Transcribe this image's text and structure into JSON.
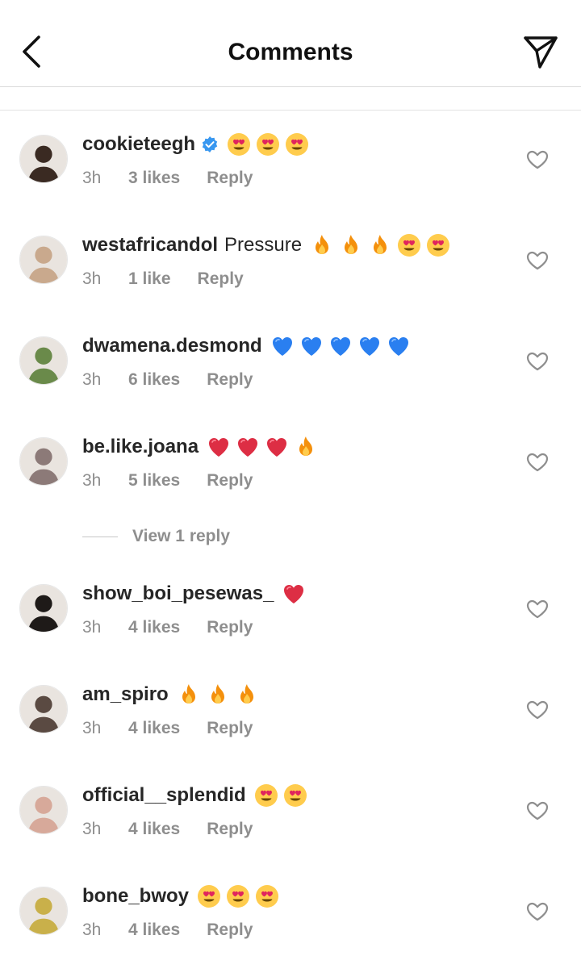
{
  "header": {
    "title": "Comments",
    "back_icon": "chevron-left-icon",
    "send_icon": "paper-plane-icon"
  },
  "comments": [
    {
      "username": "cookieteegh",
      "verified": true,
      "text": "",
      "emojis": [
        "heart-eyes",
        "heart-eyes",
        "heart-eyes"
      ],
      "time": "3h",
      "likes": "3 likes",
      "reply": "Reply",
      "avatar_color": "#3a2a22"
    },
    {
      "username": "westafricandol",
      "verified": false,
      "text": "Pressure",
      "emojis": [
        "fire",
        "fire",
        "fire",
        "heart-eyes",
        "heart-eyes"
      ],
      "time": "3h",
      "likes": "1 like",
      "reply": "Reply",
      "avatar_color": "#c9a98d"
    },
    {
      "username": "dwamena.desmond",
      "verified": false,
      "text": "",
      "emojis": [
        "blue-heart",
        "blue-heart",
        "blue-heart",
        "blue-heart",
        "blue-heart"
      ],
      "time": "3h",
      "likes": "6 likes",
      "reply": "Reply",
      "avatar_color": "#6a8a4a"
    },
    {
      "username": "be.like.joana",
      "verified": false,
      "text": "",
      "emojis": [
        "red-heart",
        "red-heart",
        "red-heart",
        "fire"
      ],
      "time": "3h",
      "likes": "5 likes",
      "reply": "Reply",
      "avatar_color": "#8c7a78"
    },
    {
      "username": "show_boi_pesewas_",
      "verified": false,
      "text": "",
      "emojis": [
        "red-heart"
      ],
      "time": "3h",
      "likes": "4 likes",
      "reply": "Reply",
      "avatar_color": "#1e1a18"
    },
    {
      "username": "am_spiro",
      "verified": false,
      "text": "",
      "emojis": [
        "fire",
        "fire",
        "fire"
      ],
      "time": "3h",
      "likes": "4 likes",
      "reply": "Reply",
      "avatar_color": "#5a4a42"
    },
    {
      "username": "official__splendid",
      "verified": false,
      "text": "",
      "emojis": [
        "heart-eyes",
        "heart-eyes"
      ],
      "time": "3h",
      "likes": "4 likes",
      "reply": "Reply",
      "avatar_color": "#d7a99a"
    },
    {
      "username": "bone_bwoy",
      "verified": false,
      "text": "",
      "emojis": [
        "heart-eyes",
        "heart-eyes",
        "heart-eyes"
      ],
      "time": "3h",
      "likes": "4 likes",
      "reply": "Reply",
      "avatar_color": "#c9b04a"
    }
  ],
  "view_replies": {
    "label": "View 1 reply"
  },
  "colors": {
    "text": "#262626",
    "meta": "#8e8e8e",
    "verified": "#3897f0",
    "divider": "#dbdbdb"
  }
}
